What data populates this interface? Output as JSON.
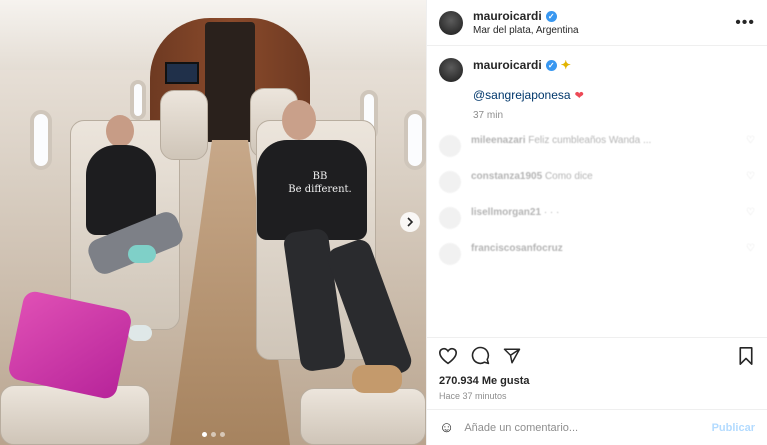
{
  "post": {
    "media": {
      "shirt_text_line1": "BB",
      "shirt_text_line2": "Be different.",
      "next_icon": "chevron-right-icon",
      "carousel_dots": 3,
      "active_dot": 0
    },
    "header": {
      "username": "mauroicardi",
      "verified": true,
      "location": "Mar del plata, Argentina",
      "more_icon": "more-horizontal-icon",
      "more_label": "•••"
    },
    "caption": {
      "username": "mauroicardi",
      "mention": "@sangrejaponesa",
      "time": "37 min"
    },
    "blurred_comments": [
      {
        "user": "mileenazari",
        "text": "Feliz cumbleaños Wanda ..."
      },
      {
        "user": "constanza1905",
        "text": "Como dice"
      },
      {
        "user": "lisellmorgan21",
        "text": "· · ·"
      },
      {
        "user": "franciscosanfocruz",
        "text": ""
      }
    ],
    "actions": {
      "like_icon": "heart-icon",
      "comment_icon": "comment-icon",
      "share_icon": "send-icon",
      "save_icon": "bookmark-icon"
    },
    "likes": "270.934 Me gusta",
    "posted_ago": "Hace 37 minutos",
    "add_comment": {
      "emoji_icon": "smiley-icon",
      "placeholder": "Añade un comentario...",
      "publish_label": "Publicar",
      "publish_color": "#b3dbff"
    }
  }
}
